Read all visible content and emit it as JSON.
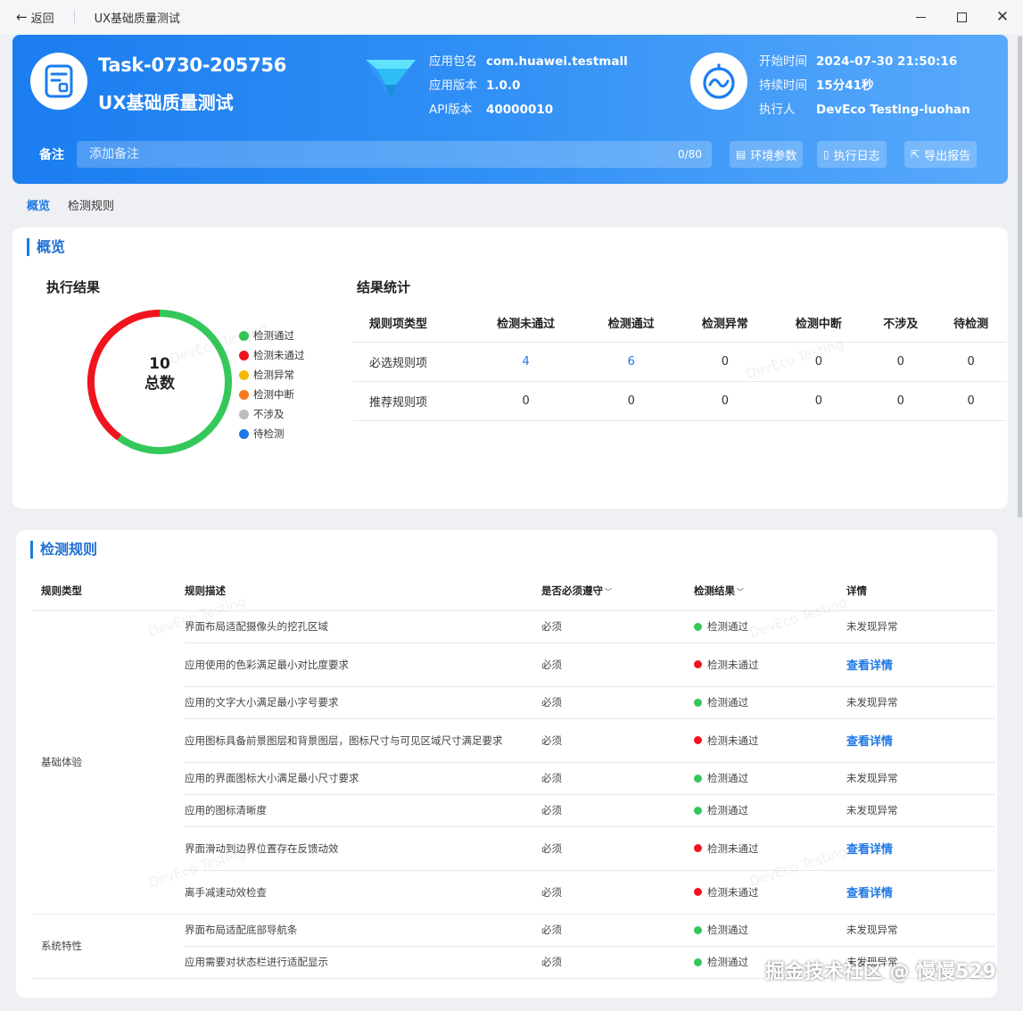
{
  "titlebar": {
    "back_label": "返回",
    "window_title": "UX基础质量测试"
  },
  "header": {
    "task_id": "Task-0730-205756",
    "task_name": "UX基础质量测试",
    "app_package_label": "应用包名",
    "app_package": "com.huawei.testmall",
    "app_version_label": "应用版本",
    "app_version": "1.0.0",
    "api_version_label": "API版本",
    "api_version": "40000010",
    "start_time_label": "开始时间",
    "start_time": "2024-07-30 21:50:16",
    "duration_label": "持续时间",
    "duration": "15分41秒",
    "executor_label": "执行人",
    "executor": "DevEco Testing-luohan",
    "remark_label": "备注",
    "remark_placeholder": "添加备注",
    "remark_count": "0/80",
    "env_params_label": "环境参数",
    "exec_log_label": "执行日志",
    "export_report_label": "导出报告"
  },
  "tabs": [
    {
      "label": "概览"
    },
    {
      "label": "检测规则"
    }
  ],
  "overview": {
    "title": "概览",
    "exec_result_title": "执行结果",
    "total_value": "10",
    "total_label": "总数",
    "legend": [
      {
        "label": "检测通过",
        "color": "#34c759"
      },
      {
        "label": "检测未通过",
        "color": "#f0141e"
      },
      {
        "label": "检测异常",
        "color": "#f5b800"
      },
      {
        "label": "检测中断",
        "color": "#f57a1f"
      },
      {
        "label": "不涉及",
        "color": "#bdbdbd"
      },
      {
        "label": "待检测",
        "color": "#1f78e5"
      }
    ],
    "stats_title": "结果统计",
    "stats_headers": [
      "规则项类型",
      "检测未通过",
      "检测通过",
      "检测异常",
      "检测中断",
      "不涉及",
      "待检测"
    ],
    "stats_rows": [
      {
        "type": "必选规则项",
        "failed": "4",
        "passed": "6",
        "abnormal": "0",
        "interrupted": "0",
        "na": "0",
        "pending": "0"
      },
      {
        "type": "推荐规则项",
        "failed": "0",
        "passed": "0",
        "abnormal": "0",
        "interrupted": "0",
        "na": "0",
        "pending": "0"
      }
    ]
  },
  "chart_data": {
    "type": "pie",
    "categories": [
      "检测通过",
      "检测未通过",
      "检测异常",
      "检测中断",
      "不涉及",
      "待检测"
    ],
    "values": [
      6,
      4,
      0,
      0,
      0,
      0
    ],
    "colors": [
      "#34c759",
      "#f0141e",
      "#f5b800",
      "#f57a1f",
      "#bdbdbd",
      "#1f78e5"
    ],
    "donut": true,
    "center_text": "10 总数"
  },
  "rules": {
    "title": "检测规则",
    "headers": {
      "type": "规则类型",
      "desc": "规则描述",
      "must": "是否必须遵守",
      "result": "检测结果",
      "detail": "详情"
    },
    "groups": [
      {
        "type": "基础体验",
        "rows": [
          {
            "desc": "界面布局适配摄像头的挖孔区域",
            "must": "必须",
            "result": "检测通过",
            "status": "pass",
            "detail": "未发现异常"
          },
          {
            "desc": "应用使用的色彩满足最小对比度要求",
            "must": "必须",
            "result": "检测未通过",
            "status": "fail",
            "detail": "查看详情"
          },
          {
            "desc": "应用的文字大小满足最小字号要求",
            "must": "必须",
            "result": "检测通过",
            "status": "pass",
            "detail": "未发现异常"
          },
          {
            "desc": "应用图标具备前景图层和背景图层，图标尺寸与可见区域尺寸满足要求",
            "must": "必须",
            "result": "检测未通过",
            "status": "fail",
            "detail": "查看详情"
          },
          {
            "desc": "应用的界面图标大小满足最小尺寸要求",
            "must": "必须",
            "result": "检测通过",
            "status": "pass",
            "detail": "未发现异常"
          },
          {
            "desc": "应用的图标清晰度",
            "must": "必须",
            "result": "检测通过",
            "status": "pass",
            "detail": "未发现异常"
          },
          {
            "desc": "界面滑动到边界位置存在反馈动效",
            "must": "必须",
            "result": "检测未通过",
            "status": "fail",
            "detail": "查看详情"
          },
          {
            "desc": "离手减速动效检查",
            "must": "必须",
            "result": "检测未通过",
            "status": "fail",
            "detail": "查看详情"
          }
        ]
      },
      {
        "type": "系统特性",
        "rows": [
          {
            "desc": "界面布局适配底部导航条",
            "must": "必须",
            "result": "检测通过",
            "status": "pass",
            "detail": "未发现异常"
          },
          {
            "desc": "应用需要对状态栏进行适配显示",
            "must": "必须",
            "result": "检测通过",
            "status": "pass",
            "detail": "未发现异常"
          }
        ]
      }
    ]
  },
  "watermark": "DevEco Testing",
  "corner_watermark": "掘金技术社区 @ 慢慢529"
}
